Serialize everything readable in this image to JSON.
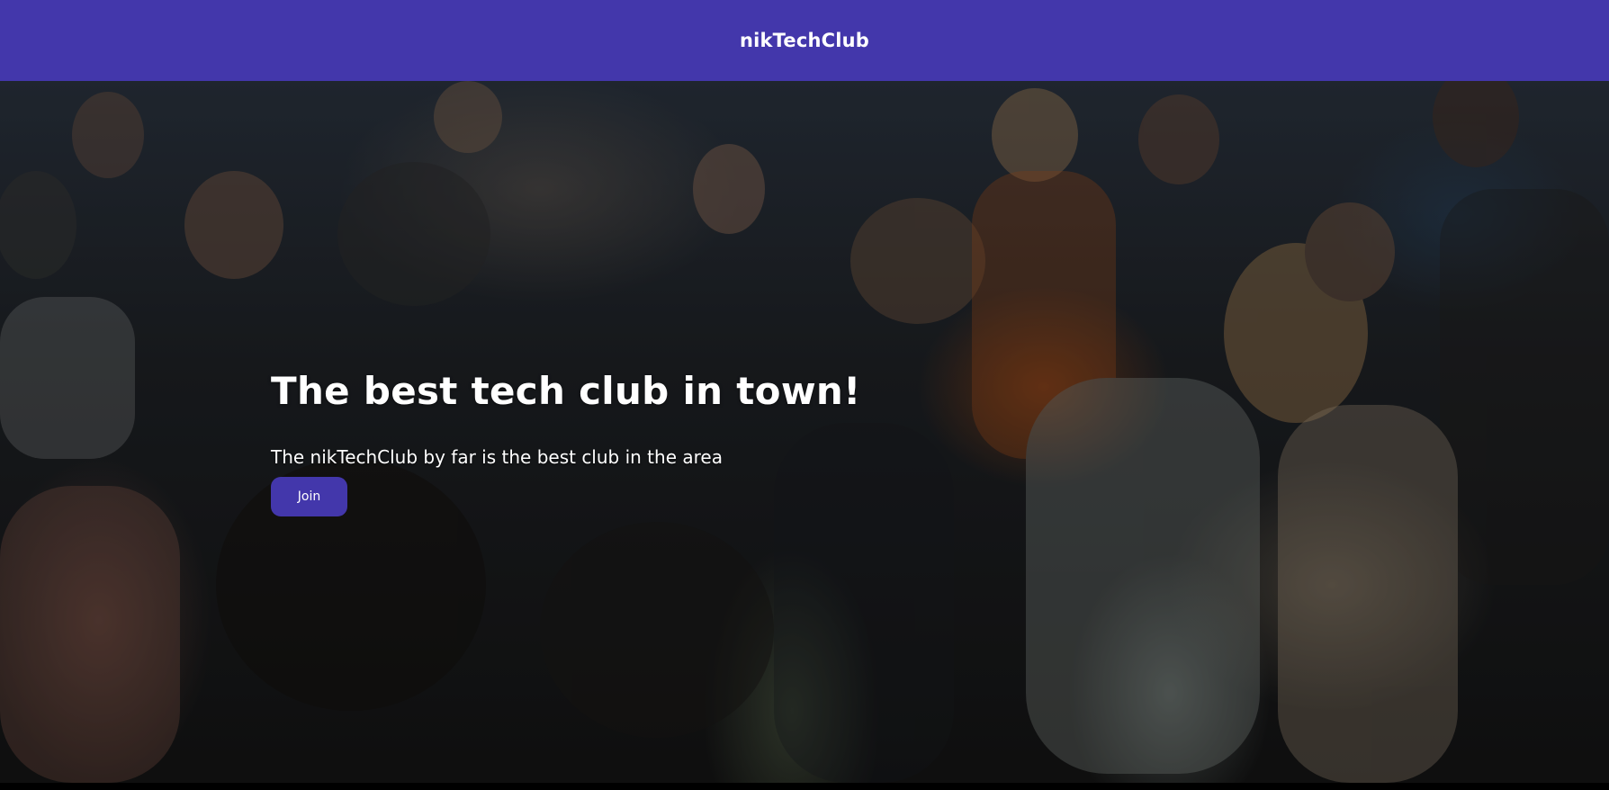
{
  "header": {
    "brand": "nikTechClub",
    "background_color": "#4337ab"
  },
  "hero": {
    "image_alt": "Group of people joining fists in a huddle",
    "title": "The best tech club in town!",
    "subtitle": "The nikTechClub by far is the best club in the area",
    "cta_label": "Join",
    "cta_color": "#4337ab"
  }
}
